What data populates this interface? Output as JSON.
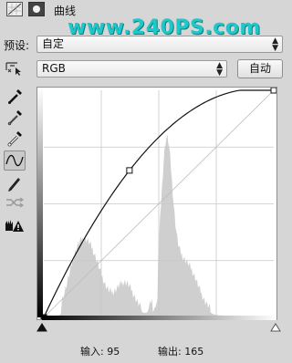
{
  "header": {
    "title": "曲线",
    "watermark": "www.240PS.com"
  },
  "preset": {
    "label": "预设:",
    "value": "自定"
  },
  "channel": {
    "value": "RGB",
    "auto_button": "自动"
  },
  "tools": [
    "target-adjust-icon",
    "black-eyedropper-icon",
    "gray-eyedropper-icon",
    "white-eyedropper-icon",
    "curve-points-icon",
    "pencil-icon",
    "smooth-icon",
    "clipping-warning-icon"
  ],
  "curve": {
    "points": [
      [
        0,
        0
      ],
      [
        95,
        165
      ],
      [
        255,
        255
      ]
    ]
  },
  "readout": {
    "input_label": "输入:",
    "input_value": "95",
    "output_label": "输出:",
    "output_value": "165"
  }
}
